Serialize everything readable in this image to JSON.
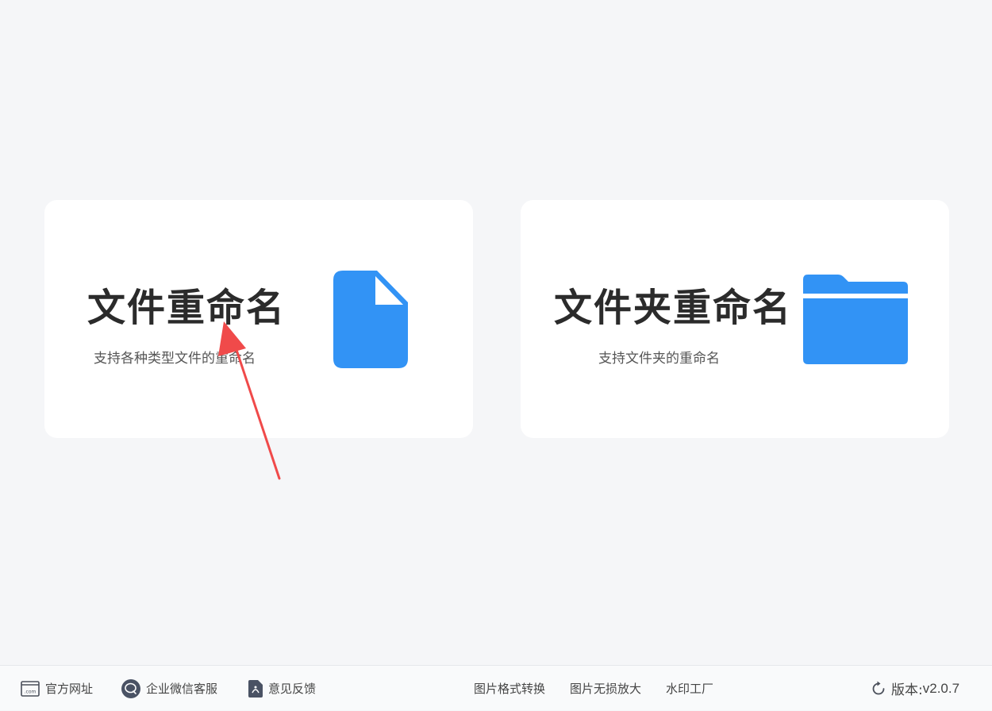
{
  "cards": [
    {
      "title": "文件重命名",
      "desc": "支持各种类型文件的重命名",
      "icon": "file-icon"
    },
    {
      "title": "文件夹重命名",
      "desc": "支持文件夹的重命名",
      "icon": "folder-icon"
    }
  ],
  "footer": {
    "official_site": "官方网址",
    "wechat_service": "企业微信客服",
    "feedback": "意见反馈",
    "image_convert": "图片格式转换",
    "image_enlarge": "图片无损放大",
    "watermark": "水印工厂",
    "version_label": "版本:",
    "version_number": "v2.0.7"
  },
  "colors": {
    "accent_blue": "#3293f5",
    "background": "#f5f6f8",
    "card": "#ffffff",
    "annotation_red": "#f04a4a"
  }
}
